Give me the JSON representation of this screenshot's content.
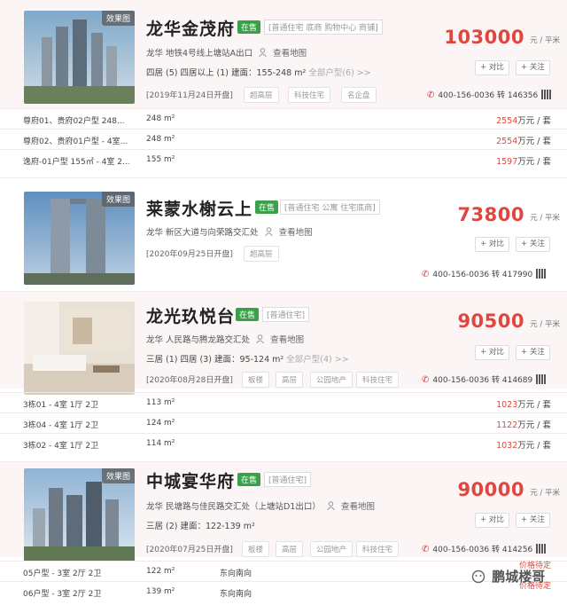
{
  "listings": [
    {
      "name": "龙华金茂府",
      "status": "在售",
      "kind": "[普通住宅 底商 购物中心 商铺]",
      "image_tag": "效果图",
      "address": "龙华 地铁4号线上塘站A出口",
      "map_link": "查看地图",
      "rooms": "四居 (5)   四居以上 (1)   建面：155-248 m²",
      "rooms_all": "全部户型(6) >>",
      "date": "[2019年11月24日开盘]",
      "tags": [
        "超高层",
        "科技住宅",
        "名企盘"
      ],
      "price": "103000",
      "unit": "元 / 平米",
      "compare": "+ 对比",
      "follow": "+ 关注",
      "phone": "400-156-0036 转 146356",
      "units": [
        {
          "type": "尊府01、贵府02户型 248...",
          "area": "248 m²",
          "orient": "",
          "total": "2554",
          "suffix": "万元 / 套"
        },
        {
          "type": "尊府02、贵府01户型 - 4室...",
          "area": "248 m²",
          "orient": "",
          "total": "2554",
          "suffix": "万元 / 套"
        },
        {
          "type": "逸府-01户型 155㎡ - 4室 2...",
          "area": "155 m²",
          "orient": "",
          "total": "1597",
          "suffix": "万元 / 套"
        }
      ]
    },
    {
      "name": "莱蒙水榭云上",
      "status": "在售",
      "kind": "[普通住宅 公寓 住宅底商]",
      "image_tag": "效果图",
      "address": "龙华 新区大道与向荣路交汇处",
      "map_link": "查看地图",
      "rooms": "",
      "rooms_all": "",
      "date": "[2020年09月25日开盘]",
      "tags": [
        "超高层"
      ],
      "price": "73800",
      "unit": "元 / 平米",
      "compare": "+ 对比",
      "follow": "+ 关注",
      "phone": "400-156-0036 转 417990",
      "units": []
    },
    {
      "name": "龙光玖悦台",
      "status": "在售",
      "kind": "[普通住宅]",
      "image_tag": "",
      "address": "龙华 人民路与腾龙路交汇处",
      "map_link": "查看地图",
      "rooms": "三居 (1)   四居 (3)   建面：95-124 m²",
      "rooms_all": "全部户型(4) >>",
      "date": "[2020年08月28日开盘]",
      "tags": [
        "板楼",
        "高层",
        "公园地产",
        "科技住宅"
      ],
      "price": "90500",
      "unit": "元 / 平米",
      "compare": "+ 对比",
      "follow": "+ 关注",
      "phone": "400-156-0036 转 414689",
      "units": [
        {
          "type": "3栋01 - 4室 1厅 2卫",
          "area": "113 m²",
          "orient": "",
          "total": "1023",
          "suffix": "万元 / 套"
        },
        {
          "type": "3栋04 - 4室 1厅 2卫",
          "area": "124 m²",
          "orient": "",
          "total": "1122",
          "suffix": "万元 / 套"
        },
        {
          "type": "3栋02 - 4室 1厅 2卫",
          "area": "114 m²",
          "orient": "",
          "total": "1032",
          "suffix": "万元 / 套"
        }
      ]
    },
    {
      "name": "中城宴华府",
      "status": "在售",
      "kind": "[普通住宅]",
      "image_tag": "效果图",
      "address": "龙华 民塘路与佳民路交汇处（上塘站D1出口）",
      "map_link": "查看地图",
      "rooms": "三居 (2)   建面：122-139 m²",
      "rooms_all": "",
      "date": "[2020年07月25日开盘]",
      "tags": [
        "板楼",
        "高层",
        "公园地产",
        "科技住宅"
      ],
      "price": "90000",
      "unit": "元 / 平米",
      "compare": "+ 对比",
      "follow": "+ 关注",
      "phone": "400-156-0036 转 414256",
      "units": [
        {
          "type": "05户型 - 3室 2厅 2卫",
          "area": "122 m²",
          "orient": "东向南向",
          "pending": "价格待定"
        },
        {
          "type": "06户型 - 3室 2厅 2卫",
          "area": "139 m²",
          "orient": "东向南向",
          "pending": "价格待定"
        }
      ]
    }
  ],
  "watermark": "鹏城楼哥",
  "colors": {
    "price": "#e0463f",
    "status": "#3aa14a",
    "alt_bg": "#fbf6f5"
  }
}
